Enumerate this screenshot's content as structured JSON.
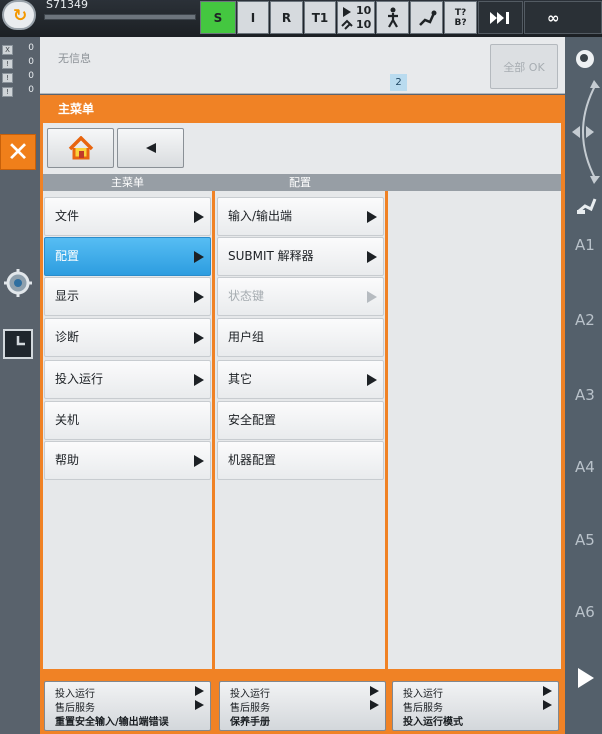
{
  "statusbar": {
    "program_name": "S71349",
    "submit_state": "S",
    "drive_state": "I",
    "run_state": "R",
    "mode": "T1",
    "override_prog": "10",
    "override_jog": "10",
    "tool_base": "T?\nB?",
    "speed_infinite": "∞"
  },
  "leds": [
    {
      "box": "X",
      "value": "0"
    },
    {
      "box": "!",
      "value": "0"
    },
    {
      "box": "!",
      "value": "0"
    },
    {
      "box": "!",
      "value": "0"
    }
  ],
  "messages": {
    "text": "无信息",
    "count": "2",
    "ack_all_label": "全部 OK"
  },
  "menu": {
    "title": "主菜单",
    "columns": [
      "主菜单",
      "配置"
    ],
    "main_items": [
      {
        "label": "文件",
        "has_sub": true,
        "selected": false
      },
      {
        "label": "配置",
        "has_sub": true,
        "selected": true
      },
      {
        "label": "显示",
        "has_sub": true,
        "selected": false
      },
      {
        "label": "诊断",
        "has_sub": true,
        "selected": false
      },
      {
        "label": "投入运行",
        "has_sub": true,
        "selected": false
      },
      {
        "label": "关机",
        "has_sub": false,
        "selected": false
      },
      {
        "label": "帮助",
        "has_sub": true,
        "selected": false
      }
    ],
    "config_items": [
      {
        "label": "输入/输出端",
        "has_sub": true,
        "disabled": false
      },
      {
        "label": "SUBMIT 解释器",
        "has_sub": true,
        "disabled": false
      },
      {
        "label": "状态键",
        "has_sub": true,
        "disabled": true
      },
      {
        "label": "用户组",
        "has_sub": false,
        "disabled": false
      },
      {
        "label": "其它",
        "has_sub": true,
        "disabled": false
      },
      {
        "label": "安全配置",
        "has_sub": false,
        "disabled": false
      },
      {
        "label": "机器配置",
        "has_sub": false,
        "disabled": false
      }
    ]
  },
  "axes": [
    "A1",
    "A2",
    "A3",
    "A4",
    "A5",
    "A6"
  ],
  "shortcuts": [
    {
      "lines": [
        "投入运行",
        "售后服务",
        "重置安全输入/输出端错误"
      ]
    },
    {
      "lines": [
        "投入运行",
        "售后服务",
        "保养手册"
      ]
    },
    {
      "lines": [
        "投入运行",
        "售后服务",
        "投入运行模式"
      ]
    }
  ],
  "colors": {
    "accent": "#f08225",
    "selected": "#2d9de0",
    "green_state": "#44c740"
  }
}
